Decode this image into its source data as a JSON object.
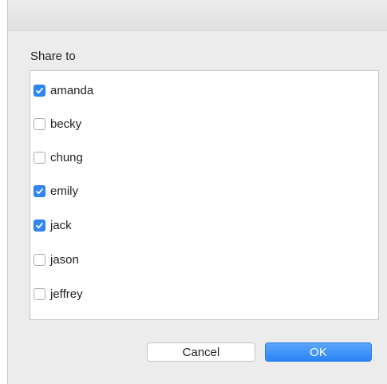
{
  "dialog": {
    "title": "Share to",
    "users": [
      {
        "name": "amanda",
        "checked": true
      },
      {
        "name": "becky",
        "checked": false
      },
      {
        "name": "chung",
        "checked": false
      },
      {
        "name": "emily",
        "checked": true
      },
      {
        "name": "jack",
        "checked": true
      },
      {
        "name": "jason",
        "checked": false
      },
      {
        "name": "jeffrey",
        "checked": false
      }
    ],
    "cancel_label": "Cancel",
    "ok_label": "OK"
  },
  "colors": {
    "accent": "#2f86f5",
    "background": "#ececec"
  },
  "icons": {
    "check": "checkmark-icon"
  }
}
